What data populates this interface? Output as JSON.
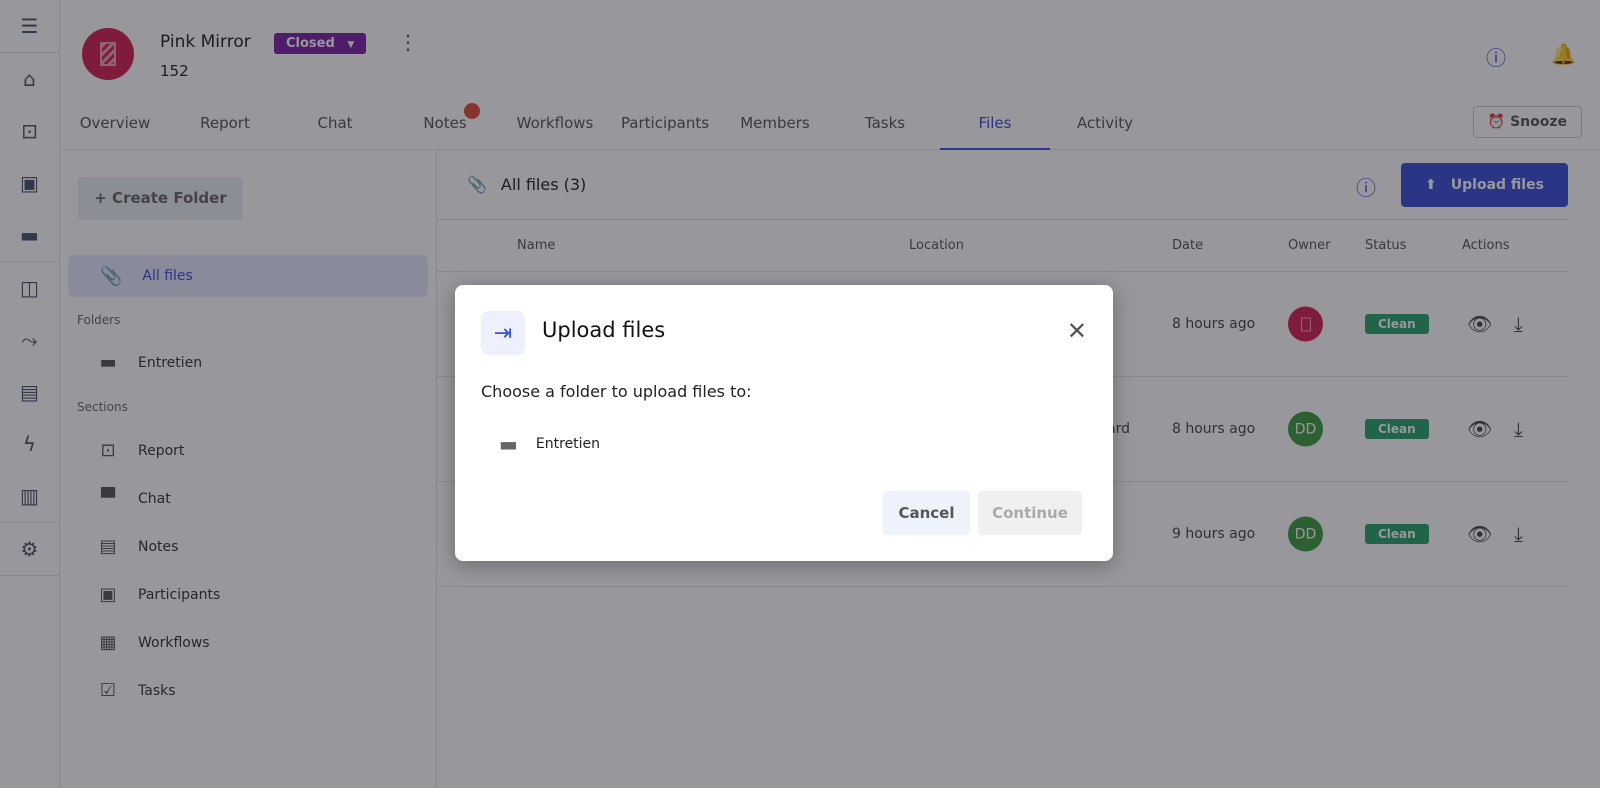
{
  "rail": {
    "items": [
      {
        "icon": "menu-icon",
        "glyph": "☰"
      },
      {
        "icon": "home-icon",
        "glyph": "⌂"
      },
      {
        "icon": "inbox-icon",
        "glyph": "⊡"
      },
      {
        "icon": "contact-calendar-icon",
        "glyph": "▣"
      },
      {
        "icon": "folder-icon",
        "glyph": "▬"
      },
      {
        "icon": "dashboard-icon",
        "glyph": "◫"
      },
      {
        "icon": "merge-icon",
        "glyph": "⤳"
      },
      {
        "icon": "clipboard-icon",
        "glyph": "▤"
      },
      {
        "icon": "bolt-icon",
        "glyph": "ϟ"
      },
      {
        "icon": "bar-chart-icon",
        "glyph": "▥"
      },
      {
        "icon": "gear-icon",
        "glyph": "⚙"
      }
    ]
  },
  "header": {
    "title": "Pink Mirror",
    "number": "152",
    "status": "Closed",
    "snooze": "Snooze"
  },
  "tabs": [
    "Overview",
    "Report",
    "Chat",
    "Notes",
    "Workflows",
    "Participants",
    "Members",
    "Tasks",
    "Files",
    "Activity"
  ],
  "active_tab": "Files",
  "left": {
    "create_folder": "+ Create Folder",
    "all_files": "All files",
    "folders_label": "Folders",
    "folders": [
      "Entretien"
    ],
    "sections_label": "Sections",
    "sections": [
      {
        "label": "Report",
        "glyph": "⊡"
      },
      {
        "label": "Chat",
        "glyph": "▀"
      },
      {
        "label": "Notes",
        "glyph": "▤"
      },
      {
        "label": "Participants",
        "glyph": "▣"
      },
      {
        "label": "Workflows",
        "glyph": "▦"
      },
      {
        "label": "Tasks",
        "glyph": "☑"
      }
    ]
  },
  "main": {
    "title": "All files (3)",
    "upload": "Upload files",
    "columns": {
      "name": "Name",
      "location": "Location",
      "date": "Date",
      "owner": "Owner",
      "status": "Status",
      "actions": "Actions"
    },
    "rows": [
      {
        "location": "",
        "date": "8 hours ago",
        "owner": "",
        "owner_color": "#d6204f",
        "status": "Clean"
      },
      {
        "location": "ard",
        "date": "8 hours ago",
        "owner": "DD",
        "owner_color": "#3c9b3f",
        "status": "Clean"
      },
      {
        "location": "",
        "date": "9 hours ago",
        "owner": "DD",
        "owner_color": "#3c9b3f",
        "status": "Clean"
      }
    ]
  },
  "modal": {
    "title": "Upload files",
    "description": "Choose a folder to upload files to:",
    "folders": [
      "Entretien"
    ],
    "cancel": "Cancel",
    "continue": "Continue"
  },
  "colors": {
    "accent": "#3b4ed8",
    "closed_badge": "#7b1fa2",
    "clean": "#27a36b"
  }
}
